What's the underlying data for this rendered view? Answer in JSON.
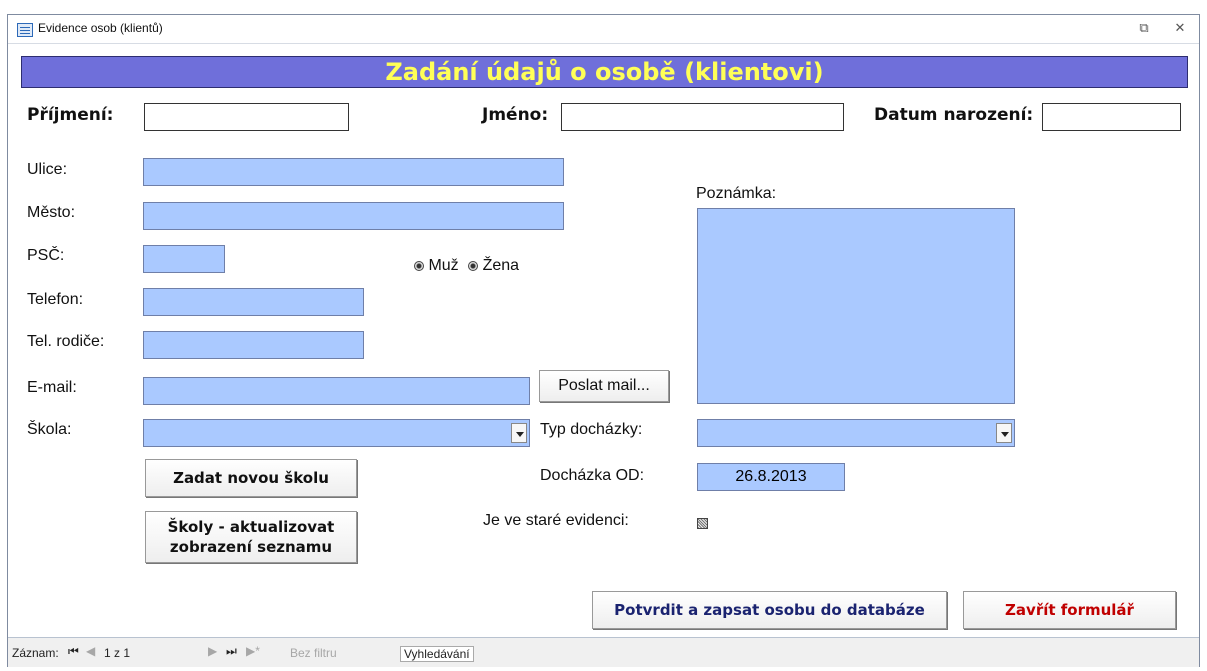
{
  "window": {
    "title": "Evidence osob (klientů)",
    "restore_icon": "restore-icon",
    "close_icon": "close-icon",
    "restore_glyph": "⧉",
    "close_glyph": "✕"
  },
  "form": {
    "header": "Zadání údajů o osobě (klientovi)",
    "fields": {
      "prijmeni_label": "Příjmení:",
      "prijmeni_value": "",
      "jmeno_label": "Jméno:",
      "jmeno_value": "",
      "datum_label": "Datum narození:",
      "datum_value": "",
      "ulice_label": "Ulice:",
      "ulice_value": "",
      "mesto_label": "Město:",
      "mesto_value": "",
      "psc_label": "PSČ:",
      "psc_value": "",
      "telefon_label": "Telefon:",
      "telefon_value": "",
      "tel_rodice_label": "Tel. rodiče:",
      "tel_rodice_value": "",
      "email_label": "E-mail:",
      "email_value": "",
      "skola_label": "Škola:",
      "skola_value": "",
      "poznamka_label": "Poznámka:",
      "poznamka_value": "",
      "typ_dochazky_label": "Typ docházky:",
      "typ_dochazky_value": "",
      "dochazka_od_label": "Docházka OD:",
      "dochazka_od_value": "26.8.2013",
      "stara_evidence_label": "Je ve staré evidenci:",
      "stara_evidence_checked": "indeterminate"
    },
    "gender": {
      "male_label": "Muž",
      "female_label": "Žena",
      "selected": "none"
    },
    "buttons": {
      "poslat_mail": "Poslat mail...",
      "zadat_skolu": "Zadat novou školu",
      "skoly_aktualizovat_line1": "Školy - aktualizovat",
      "skoly_aktualizovat_line2": "zobrazení seznamu",
      "potvrdit": "Potvrdit a zapsat osobu do databáze",
      "zavrit": "Zavřít formulář"
    },
    "colors": {
      "header_bg": "#6f6fda",
      "header_text": "#ffff57",
      "input_blue": "#aac9ff",
      "close_button_text": "#c00000"
    }
  },
  "statusbar": {
    "zaznam_label": "Záznam:",
    "first_glyph": "⏮",
    "prev_glyph": "◀",
    "record_position": "1 z 1",
    "next_glyph": "▶",
    "last_glyph": "⏭",
    "new_glyph": "▶*",
    "filter_text": "Bez filtru",
    "search_text": "Vyhledávání"
  }
}
